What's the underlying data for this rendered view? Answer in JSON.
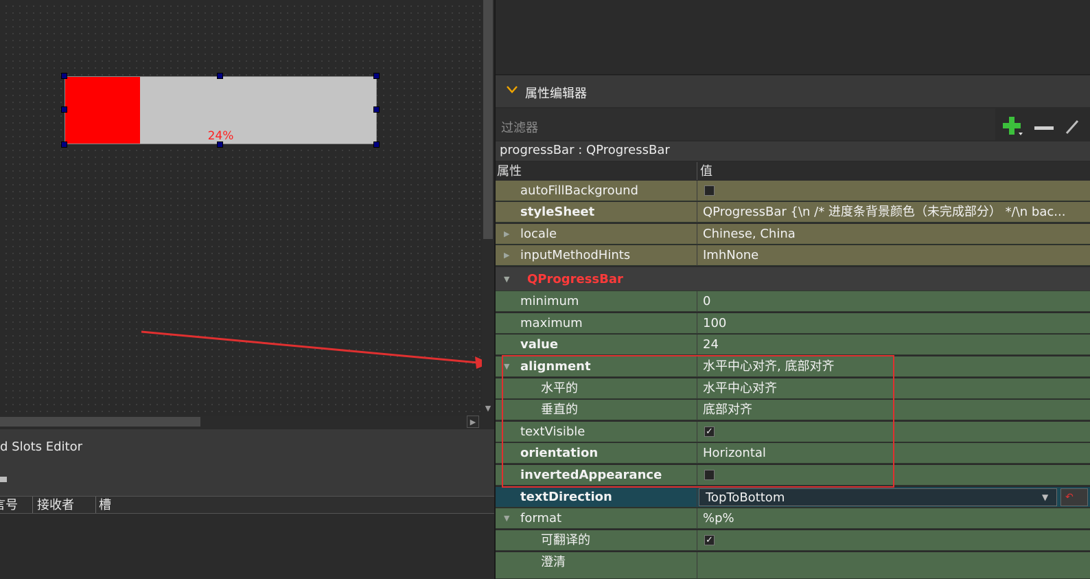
{
  "canvas": {
    "progress_value": 24,
    "progress_text": "24%",
    "fill_color": "#ff0000",
    "track_color": "#c4c4c4"
  },
  "signals": {
    "title": "d Slots Editor",
    "columns": [
      "言号",
      "接收者",
      "槽"
    ]
  },
  "property_editor": {
    "title": "属性编辑器",
    "filter_placeholder": "过滤器",
    "object_label": "progressBar : QProgressBar",
    "col_property": "属性",
    "col_value": "值",
    "rows": [
      {
        "name": "autoFillBackground",
        "value": ""
      },
      {
        "name": "styleSheet",
        "value": "QProgressBar {\\n    /* 进度条背景颜色（未完成部分） */\\n    bac..."
      },
      {
        "name": "locale",
        "value": "Chinese, China"
      },
      {
        "name": "inputMethodHints",
        "value": "ImhNone"
      },
      {
        "name": "QProgressBar",
        "value": ""
      },
      {
        "name": "minimum",
        "value": "0"
      },
      {
        "name": "maximum",
        "value": "100"
      },
      {
        "name": "value",
        "value": "24"
      },
      {
        "name": "alignment",
        "value": "水平中心对齐, 底部对齐"
      },
      {
        "name": "水平的",
        "value": "水平中心对齐"
      },
      {
        "name": "垂直的",
        "value": "底部对齐"
      },
      {
        "name": "textVisible",
        "value": ""
      },
      {
        "name": "orientation",
        "value": "Horizontal"
      },
      {
        "name": "invertedAppearance",
        "value": ""
      },
      {
        "name": "textDirection",
        "value": "TopToBottom"
      },
      {
        "name": "format",
        "value": "%p%"
      },
      {
        "name": "可翻译的",
        "value": ""
      },
      {
        "name": "澄清",
        "value": ""
      }
    ],
    "group_color": "#ff3a3a",
    "highlight_color": "#e03030"
  }
}
